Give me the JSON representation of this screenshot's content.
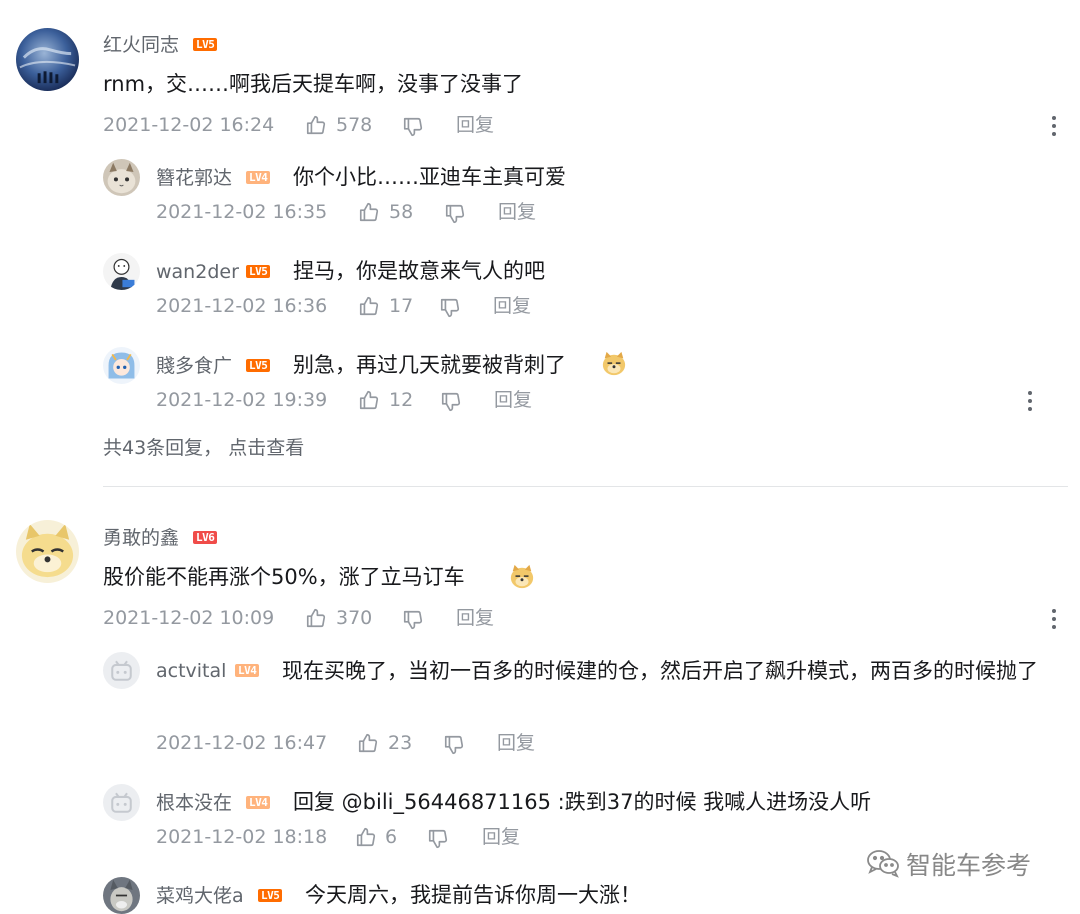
{
  "comments": [
    {
      "user": "红火同志",
      "level": "LV5",
      "text": "rnm，交……啊我后天提车啊，没事了没事了",
      "time": "2021-12-02 16:24",
      "likes": "578",
      "reply_label": "回复",
      "replies": [
        {
          "user": "簪花郭达",
          "level": "LV4",
          "text": "你个小比……亚迪车主真可爱",
          "time": "2021-12-02 16:35",
          "likes": "58",
          "reply_label": "回复"
        },
        {
          "user": "wan2der",
          "level": "LV5",
          "text": "捏马，你是故意来气人的吧",
          "time": "2021-12-02 16:36",
          "likes": "17",
          "reply_label": "回复"
        },
        {
          "user": "賤多食广",
          "level": "LV5",
          "text": "别急，再过几天就要被背刺了",
          "emoji": "doge-emoji",
          "time": "2021-12-02 19:39",
          "likes": "12",
          "reply_label": "回复"
        }
      ],
      "view_more": "共43条回复， 点击查看"
    },
    {
      "user": "勇敢的鑫",
      "level": "LV6",
      "text": "股价能不能再涨个50%，涨了立马订车",
      "emoji": "doge-emoji",
      "time": "2021-12-02 10:09",
      "likes": "370",
      "reply_label": "回复",
      "replies": [
        {
          "user": "actvital",
          "level": "LV4",
          "text": "现在买晚了，当初一百多的时候建的仓，然后开启了飙升模式，两百多的时候抛了",
          "time": "2021-12-02 16:47",
          "likes": "23",
          "reply_label": "回复"
        },
        {
          "user": "根本没在",
          "level": "LV4",
          "text": "回复 @bili_56446871165 :跌到37的时候 我喊人进场没人听",
          "time": "2021-12-02 18:18",
          "likes": "6",
          "reply_label": "回复"
        },
        {
          "user": "菜鸡大佬a",
          "level": "LV5",
          "text": "今天周六，我提前告诉你周一大涨！"
        }
      ]
    }
  ],
  "watermark": "智能车参考",
  "icons": {
    "like": "thumbs-up-icon",
    "dislike": "thumbs-down-icon",
    "more": "more-vertical-icon",
    "wechat": "wechat-icon"
  },
  "colors": {
    "lv4": "#ffb37c",
    "lv5": "#ff6c00",
    "lv6": "#f04c49",
    "meta": "#9499a0",
    "name": "#61666d"
  }
}
